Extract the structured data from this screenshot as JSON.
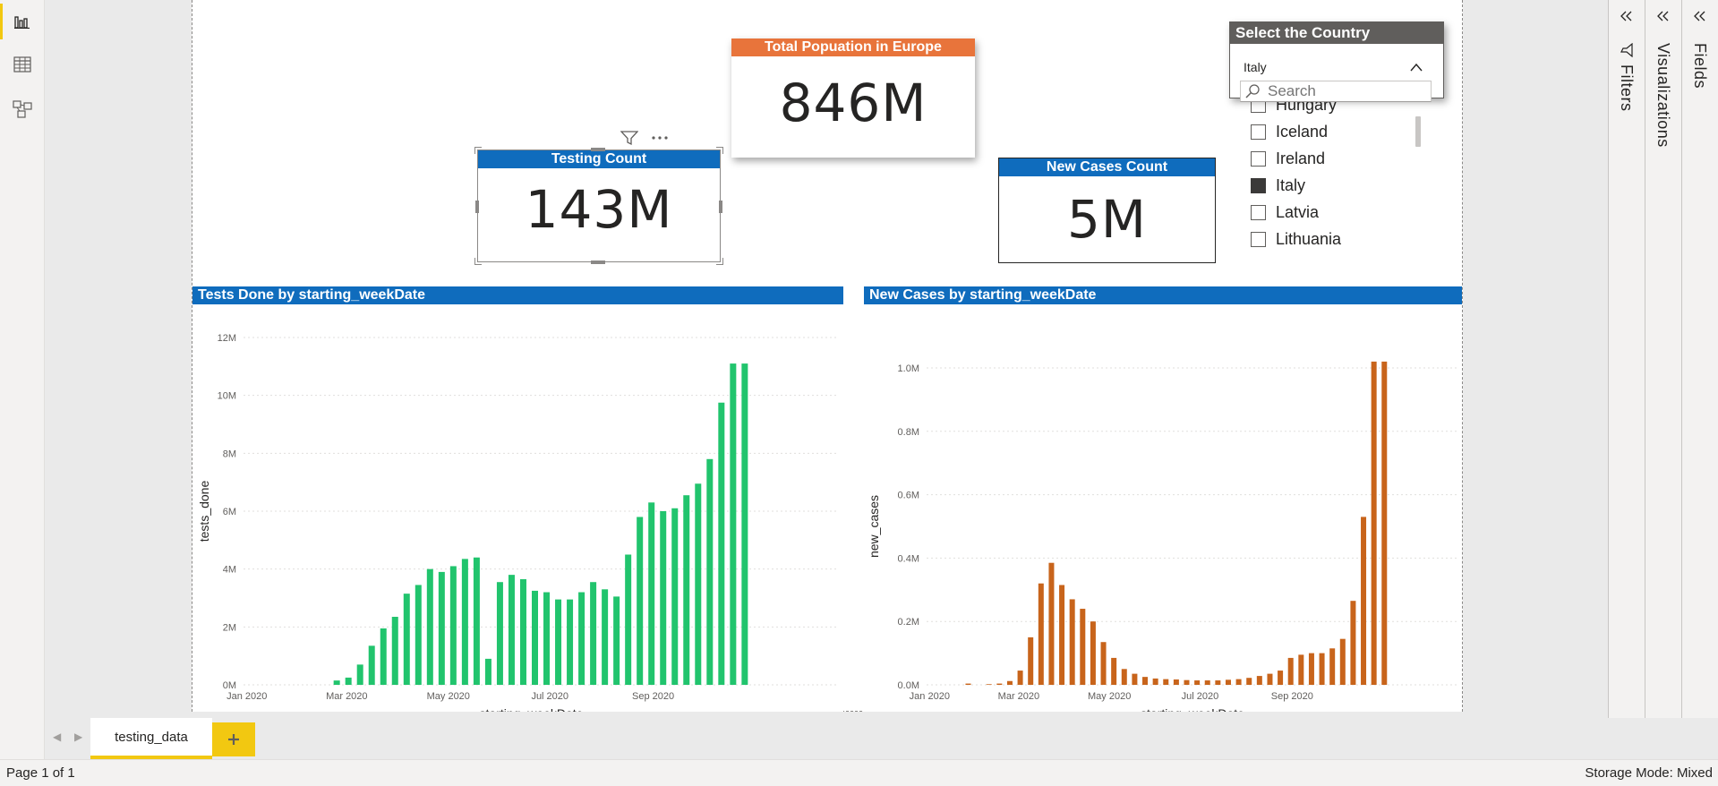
{
  "left_nav": {
    "items": [
      {
        "name": "report-view-icon",
        "active": true
      },
      {
        "name": "data-view-icon",
        "active": false
      },
      {
        "name": "model-view-icon",
        "active": false
      }
    ]
  },
  "cards": {
    "population": {
      "title": "Total Popuation in Europe",
      "value": "846M",
      "color": "#e8743b"
    },
    "tests": {
      "title": "Testing Count",
      "value": "143M",
      "color": "#0f6cbd"
    },
    "cases": {
      "title": "New Cases Count",
      "value": "5M",
      "color": "#0f6cbd"
    }
  },
  "slicer": {
    "title": "Select the Country",
    "selected": "Italy",
    "search_placeholder": "Search",
    "items": [
      {
        "label": "Hungary",
        "checked": false
      },
      {
        "label": "Iceland",
        "checked": false
      },
      {
        "label": "Ireland",
        "checked": false
      },
      {
        "label": "Italy",
        "checked": true
      },
      {
        "label": "Latvia",
        "checked": false
      },
      {
        "label": "Lithuania",
        "checked": false
      }
    ]
  },
  "chart_data": [
    {
      "type": "bar",
      "title": "Tests Done by starting_weekDate",
      "xlabel": "starting_weekDate",
      "ylabel": "tests_done",
      "color": "#21c46d",
      "x_ticks": [
        "Jan 2020",
        "Mar 2020",
        "May 2020",
        "Jul 2020",
        "Sep 2020"
      ],
      "y_ticks": [
        "0M",
        "2M",
        "4M",
        "6M",
        "8M",
        "10M",
        "12M"
      ],
      "ylim": [
        0,
        12
      ],
      "unit": "M",
      "grid": true,
      "x_start": "2019-12-30",
      "categories": [
        "2020-02-24",
        "2020-03-02",
        "2020-03-09",
        "2020-03-16",
        "2020-03-23",
        "2020-03-30",
        "2020-04-06",
        "2020-04-13",
        "2020-04-20",
        "2020-04-27",
        "2020-05-04",
        "2020-05-11",
        "2020-05-18",
        "2020-05-25",
        "2020-06-01",
        "2020-06-08",
        "2020-06-15",
        "2020-06-22",
        "2020-06-29",
        "2020-07-06",
        "2020-07-13",
        "2020-07-20",
        "2020-07-27",
        "2020-08-03",
        "2020-08-10",
        "2020-08-17",
        "2020-08-24",
        "2020-08-31",
        "2020-09-07",
        "2020-09-14",
        "2020-09-21",
        "2020-09-28",
        "2020-10-05",
        "2020-10-12",
        "2020-10-19",
        "2020-10-26"
      ],
      "values": [
        0.15,
        0.25,
        0.7,
        1.35,
        1.95,
        2.35,
        3.15,
        3.45,
        4.0,
        3.9,
        4.1,
        4.35,
        4.4,
        0.9,
        3.55,
        3.8,
        3.65,
        3.25,
        3.2,
        2.95,
        2.95,
        3.2,
        3.55,
        3.3,
        3.05,
        4.5,
        5.8,
        6.3,
        6.0,
        6.1,
        6.55,
        6.95,
        7.8,
        9.75,
        11.1,
        11.1
      ]
    },
    {
      "type": "bar",
      "title": "New Cases by starting_weekDate",
      "xlabel": "starting_weekDate",
      "ylabel": "new_cases",
      "color": "#c8641b",
      "x_ticks": [
        "Jan 2020",
        "Mar 2020",
        "May 2020",
        "Jul 2020",
        "Sep 2020"
      ],
      "y_ticks": [
        "0.0M",
        "0.2M",
        "0.4M",
        "0.6M",
        "0.8M",
        "1.0M"
      ],
      "ylim": [
        0,
        1.0
      ],
      "unit": "M",
      "grid": true,
      "x_start": "2019-12-30",
      "categories": [
        "2020-01-27",
        "2020-02-03",
        "2020-02-10",
        "2020-02-17",
        "2020-02-24",
        "2020-03-02",
        "2020-03-09",
        "2020-03-16",
        "2020-03-23",
        "2020-03-30",
        "2020-04-06",
        "2020-04-13",
        "2020-04-20",
        "2020-04-27",
        "2020-05-04",
        "2020-05-11",
        "2020-05-18",
        "2020-05-25",
        "2020-06-01",
        "2020-06-08",
        "2020-06-15",
        "2020-06-22",
        "2020-06-29",
        "2020-07-06",
        "2020-07-13",
        "2020-07-20",
        "2020-07-27",
        "2020-08-03",
        "2020-08-10",
        "2020-08-17",
        "2020-08-24",
        "2020-08-31",
        "2020-09-07",
        "2020-09-14",
        "2020-09-21",
        "2020-09-28",
        "2020-10-05",
        "2020-10-12",
        "2020-10-19",
        "2020-10-26",
        "2020-11-02"
      ],
      "values": [
        0.004,
        0.0,
        0.002,
        0.004,
        0.012,
        0.045,
        0.15,
        0.32,
        0.385,
        0.315,
        0.27,
        0.24,
        0.2,
        0.135,
        0.085,
        0.05,
        0.035,
        0.025,
        0.02,
        0.018,
        0.017,
        0.015,
        0.014,
        0.014,
        0.014,
        0.016,
        0.018,
        0.022,
        0.028,
        0.035,
        0.045,
        0.085,
        0.095,
        0.1,
        0.1,
        0.115,
        0.145,
        0.265,
        0.53,
        1.02,
        1.02
      ]
    }
  ],
  "panes": {
    "filters": "Filters",
    "visualizations": "Visualizations",
    "fields": "Fields"
  },
  "tabs": {
    "page_tab": "testing_data",
    "add_label": "+"
  },
  "status": {
    "page": "Page 1 of 1",
    "storage": "Storage Mode: Mixed"
  },
  "colors": {
    "accent": "#f2c811",
    "title_blue": "#0f6cbd",
    "orange": "#e8743b"
  }
}
